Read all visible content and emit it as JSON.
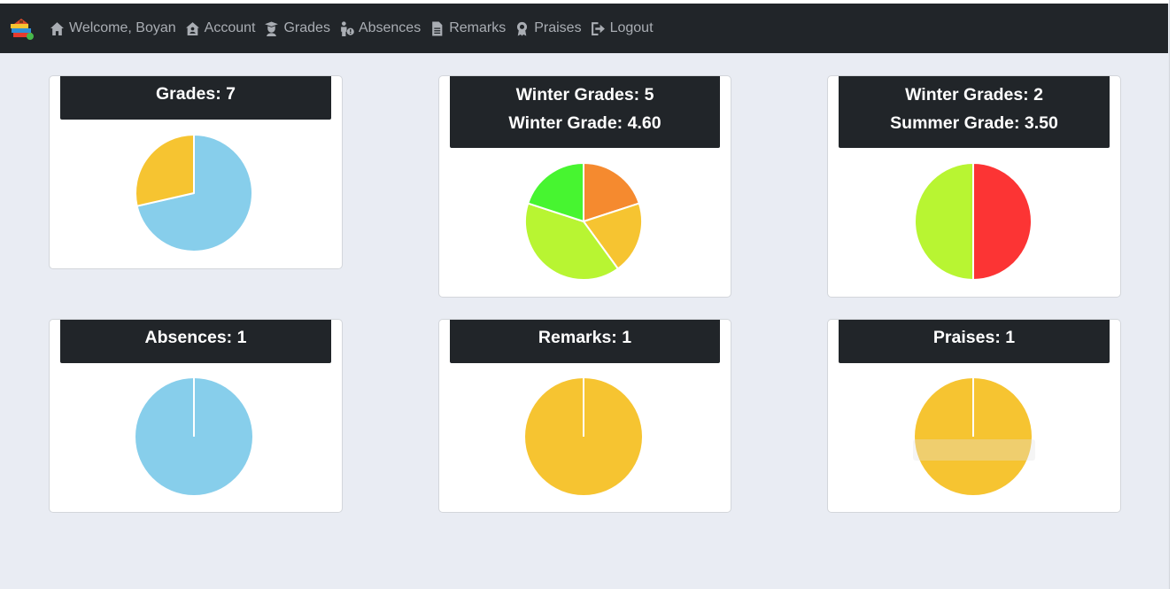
{
  "nav": {
    "brand_icon": "school-books-logo-icon",
    "items": [
      {
        "label": "Welcome, Boyan",
        "icon": "home-icon"
      },
      {
        "label": "Account",
        "icon": "account-house-icon"
      },
      {
        "label": "Grades",
        "icon": "graduate-icon"
      },
      {
        "label": "Absences",
        "icon": "person-question-icon"
      },
      {
        "label": "Remarks",
        "icon": "document-icon"
      },
      {
        "label": "Praises",
        "icon": "award-icon"
      },
      {
        "label": "Logout",
        "icon": "logout-icon"
      }
    ]
  },
  "cards": [
    {
      "lines": [
        "Grades: 7"
      ]
    },
    {
      "lines": [
        "Winter Grades: 5",
        "Winter Grade: 4.60"
      ]
    },
    {
      "lines": [
        "Winter Grades: 2",
        "Summer Grade: 3.50"
      ]
    },
    {
      "lines": [
        "Absences: 1"
      ]
    },
    {
      "lines": [
        "Remarks: 1"
      ]
    },
    {
      "lines": [
        "Praises: 1"
      ]
    }
  ],
  "chart_data": [
    {
      "type": "pie",
      "values": [
        5,
        2
      ],
      "colors": [
        "#87ceeb",
        "#f6c431"
      ]
    },
    {
      "type": "pie",
      "values": [
        1,
        1,
        2,
        1
      ],
      "colors": [
        "#f58a2f",
        "#f6c431",
        "#b8f532",
        "#47f530"
      ]
    },
    {
      "type": "pie",
      "values": [
        1,
        1
      ],
      "colors": [
        "#fc3434",
        "#b8f532"
      ]
    },
    {
      "type": "pie",
      "values": [
        1
      ],
      "colors": [
        "#87ceeb"
      ]
    },
    {
      "type": "pie",
      "values": [
        1
      ],
      "colors": [
        "#f6c431"
      ]
    },
    {
      "type": "pie",
      "values": [
        1
      ],
      "colors": [
        "#f6c431"
      ]
    }
  ]
}
